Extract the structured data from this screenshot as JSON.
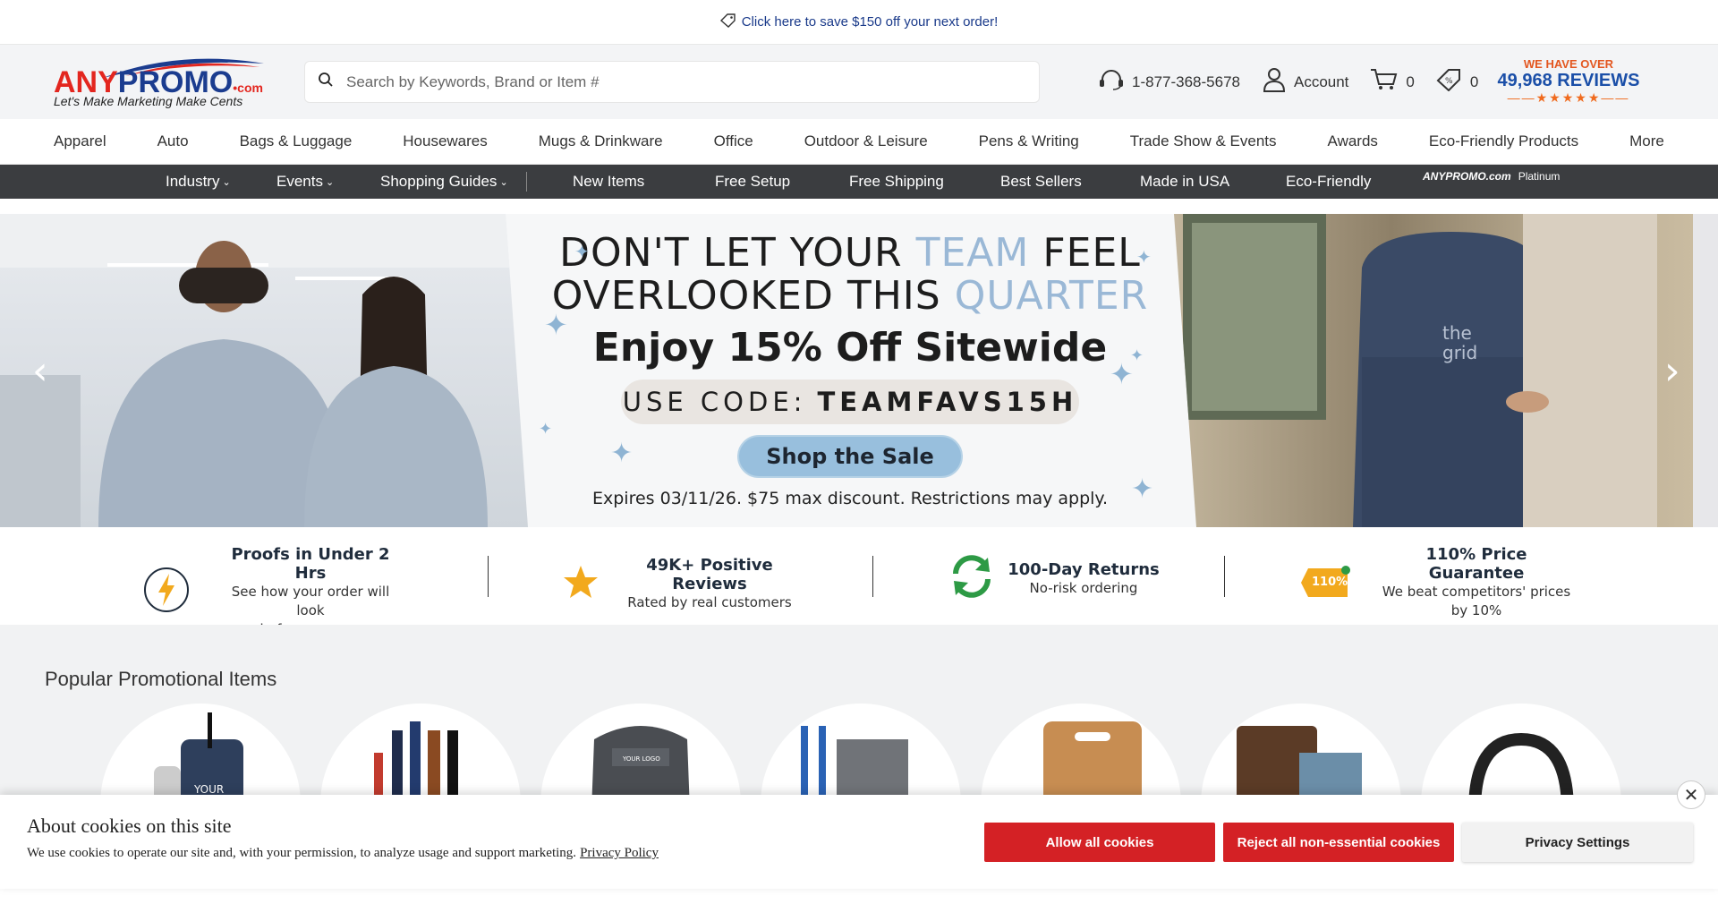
{
  "promo": {
    "text": "Click here to save $150 off your next order!",
    "icon": "tag-icon"
  },
  "logo": {
    "brand_a": "ANY",
    "brand_b": "PROMO",
    "brand_suffix": "•com",
    "tagline": "Let's Make Marketing Make Cents"
  },
  "search": {
    "placeholder": "Search by Keywords, Brand or Item #"
  },
  "header": {
    "phone": "1-877-368-5678",
    "account": "Account",
    "cart_count": "0",
    "quotes_count": "0"
  },
  "reviews": {
    "over": "WE HAVE OVER",
    "count": "49,968 REVIEWS",
    "stars": "★★★★★"
  },
  "categories": [
    "Apparel",
    "Auto",
    "Bags & Luggage",
    "Housewares",
    "Mugs & Drinkware",
    "Office",
    "Outdoor & Leisure",
    "Pens & Writing",
    "Trade Show & Events",
    "Awards",
    "Eco-Friendly Products",
    "More"
  ],
  "subnav": {
    "industry": "Industry",
    "events": "Events",
    "guides": "Shopping Guides",
    "new": "New Items",
    "setup": "Free Setup",
    "shipping": "Free Shipping",
    "best": "Best Sellers",
    "usa": "Made in USA",
    "eco": "Eco-Friendly",
    "platinum_brand": "ANYPROMO.com",
    "platinum": "Platinum"
  },
  "hero": {
    "line1_a": "DON'T LET YOUR",
    "line1_hl": "TEAM",
    "line1_b": "FEEL",
    "line2_a": "OVERLOOKED THIS",
    "line2_hl": "QUARTER",
    "headline": "Enjoy 15% Off Sitewide",
    "code_label": "USE CODE:",
    "code": "TEAMFAVS15H",
    "cta": "Shop the Sale",
    "expiry": "Expires 03/11/26. $75 max discount. Restrictions may apply."
  },
  "features": [
    {
      "title": "Proofs in Under 2 Hrs",
      "sub1": "See how your order will look",
      "sub2": "before you pay"
    },
    {
      "title": "49K+ Positive Reviews",
      "sub1": "Rated by real customers",
      "sub2": ""
    },
    {
      "title": "100-Day Returns",
      "sub1": "No-risk ordering",
      "sub2": ""
    },
    {
      "title": "110% Price Guarantee",
      "sub1": "We beat competitors' prices",
      "sub2": "by 10%"
    }
  ],
  "badge_110": "110%",
  "popular": {
    "title": "Popular Promotional Items"
  },
  "cookie": {
    "title": "About cookies on this site",
    "desc": "We use cookies to operate our site and, with your permission, to analyze usage and support marketing.",
    "policy": "Privacy Policy",
    "allow": "Allow all cookies",
    "reject": "Reject all non-essential cookies",
    "settings": "Privacy Settings",
    "close": "✕"
  }
}
